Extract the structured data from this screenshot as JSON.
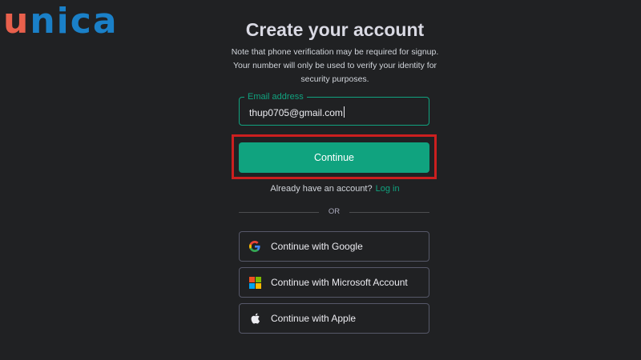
{
  "brand": {
    "logo_part1": "u",
    "logo_part2": "nica",
    "colors": {
      "primary": "#1a80c8",
      "accent": "#e8604c"
    }
  },
  "page": {
    "title": "Create your account",
    "subtitle": "Note that phone verification may be required for signup. Your number will only be used to verify your identity for security purposes."
  },
  "form": {
    "email_label": "Email address",
    "email_value": "thup0705@gmail.com",
    "continue_label": "Continue"
  },
  "login": {
    "prompt": "Already have an account?",
    "link": "Log in"
  },
  "divider_text": "OR",
  "social": {
    "google": {
      "label": "Continue with Google",
      "icon": "google-icon"
    },
    "microsoft": {
      "label": "Continue with Microsoft Account",
      "icon": "microsoft-icon"
    },
    "apple": {
      "label": "Continue with Apple",
      "icon": "apple-icon"
    }
  },
  "colors": {
    "background": "#202123",
    "accent": "#10a37f",
    "highlight": "#cc1f1f"
  }
}
